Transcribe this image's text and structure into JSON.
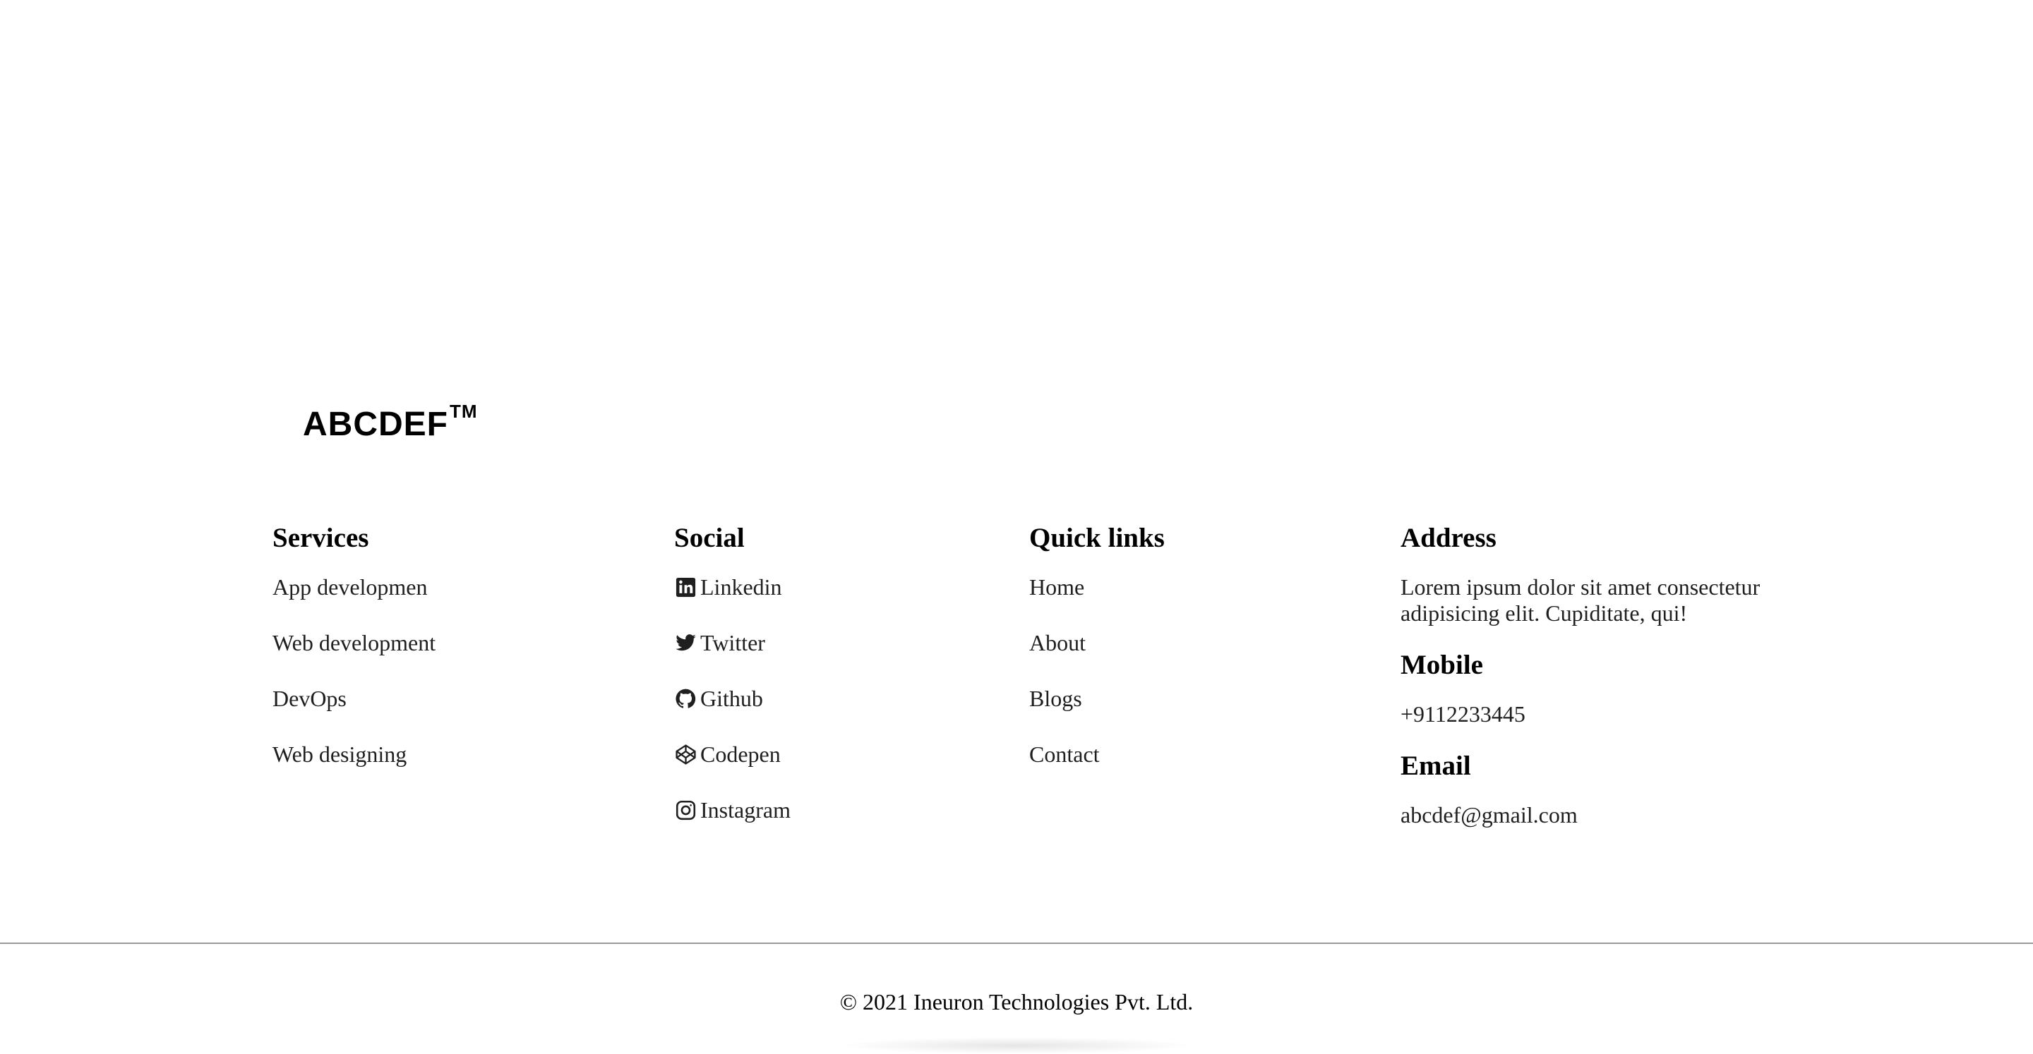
{
  "brand": {
    "name": "ABCDEF",
    "mark": "TM"
  },
  "services": {
    "heading": "Services",
    "items": [
      "App developmen",
      "Web development",
      "DevOps",
      "Web designing"
    ]
  },
  "social": {
    "heading": "Social",
    "items": [
      {
        "label": "Linkedin",
        "icon": "linkedin-icon"
      },
      {
        "label": "Twitter",
        "icon": "twitter-icon"
      },
      {
        "label": "Github",
        "icon": "github-icon"
      },
      {
        "label": "Codepen",
        "icon": "codepen-icon"
      },
      {
        "label": "Instagram",
        "icon": "instagram-icon"
      }
    ]
  },
  "quick_links": {
    "heading": "Quick links",
    "items": [
      "Home",
      "About",
      "Blogs",
      "Contact"
    ]
  },
  "contact": {
    "address_heading": "Address",
    "address_text": "Lorem ipsum dolor sit amet consectetur adipisicing elit. Cupiditate, qui!",
    "mobile_heading": "Mobile",
    "mobile": "+9112233445",
    "email_heading": "Email",
    "email": "abcdef@gmail.com"
  },
  "footer": {
    "copyright": "© 2021 Ineuron Technologies Pvt. Ltd."
  },
  "colors": {
    "text": "#1f1f1f",
    "heading": "#000000",
    "divider": "#9a9a9a",
    "background": "#ffffff"
  }
}
